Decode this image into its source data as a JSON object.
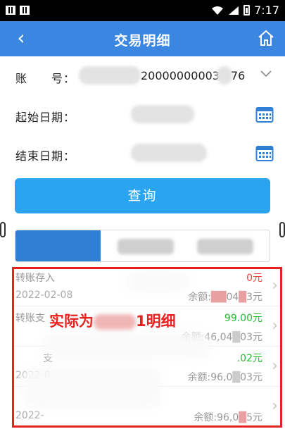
{
  "status_bar": {
    "time": "7:17"
  },
  "header": {
    "back_icon": "back-chevron-icon",
    "title": "交易明细",
    "home_icon": "home-icon"
  },
  "form": {
    "account_label": "账　　号：",
    "account_value_visible": "20000000003",
    "account_value_tail": "76",
    "start_label": "起始日期：",
    "end_label": "结束日期："
  },
  "query_button": "查询",
  "transactions": [
    {
      "type": "转账存入",
      "date": "2022-02-08",
      "amount": "0元",
      "balance": "余额:",
      "bal_tail": "04",
      "bal_end": "3元"
    },
    {
      "type": "转账支",
      "date": "",
      "amount": "99",
      "amount_tail": ".00元",
      "balance": "余额:46,04",
      "bal_end": "03元"
    },
    {
      "type": "支",
      "date": "2022-0",
      "amount": ".02元",
      "balance": "余额:96,0",
      "bal_end": "03元"
    },
    {
      "type": "",
      "date": "2022-",
      "amount": "",
      "balance": "余额:96,0",
      "bal_end": "5元"
    }
  ],
  "annotation": {
    "prefix": "实际为",
    "suffix": "1明细"
  },
  "colors": {
    "header_bg": "#3a86e0",
    "button_bg": "#2ba4ef",
    "annotation_red": "#e82020",
    "amount_green": "#22bb33"
  }
}
